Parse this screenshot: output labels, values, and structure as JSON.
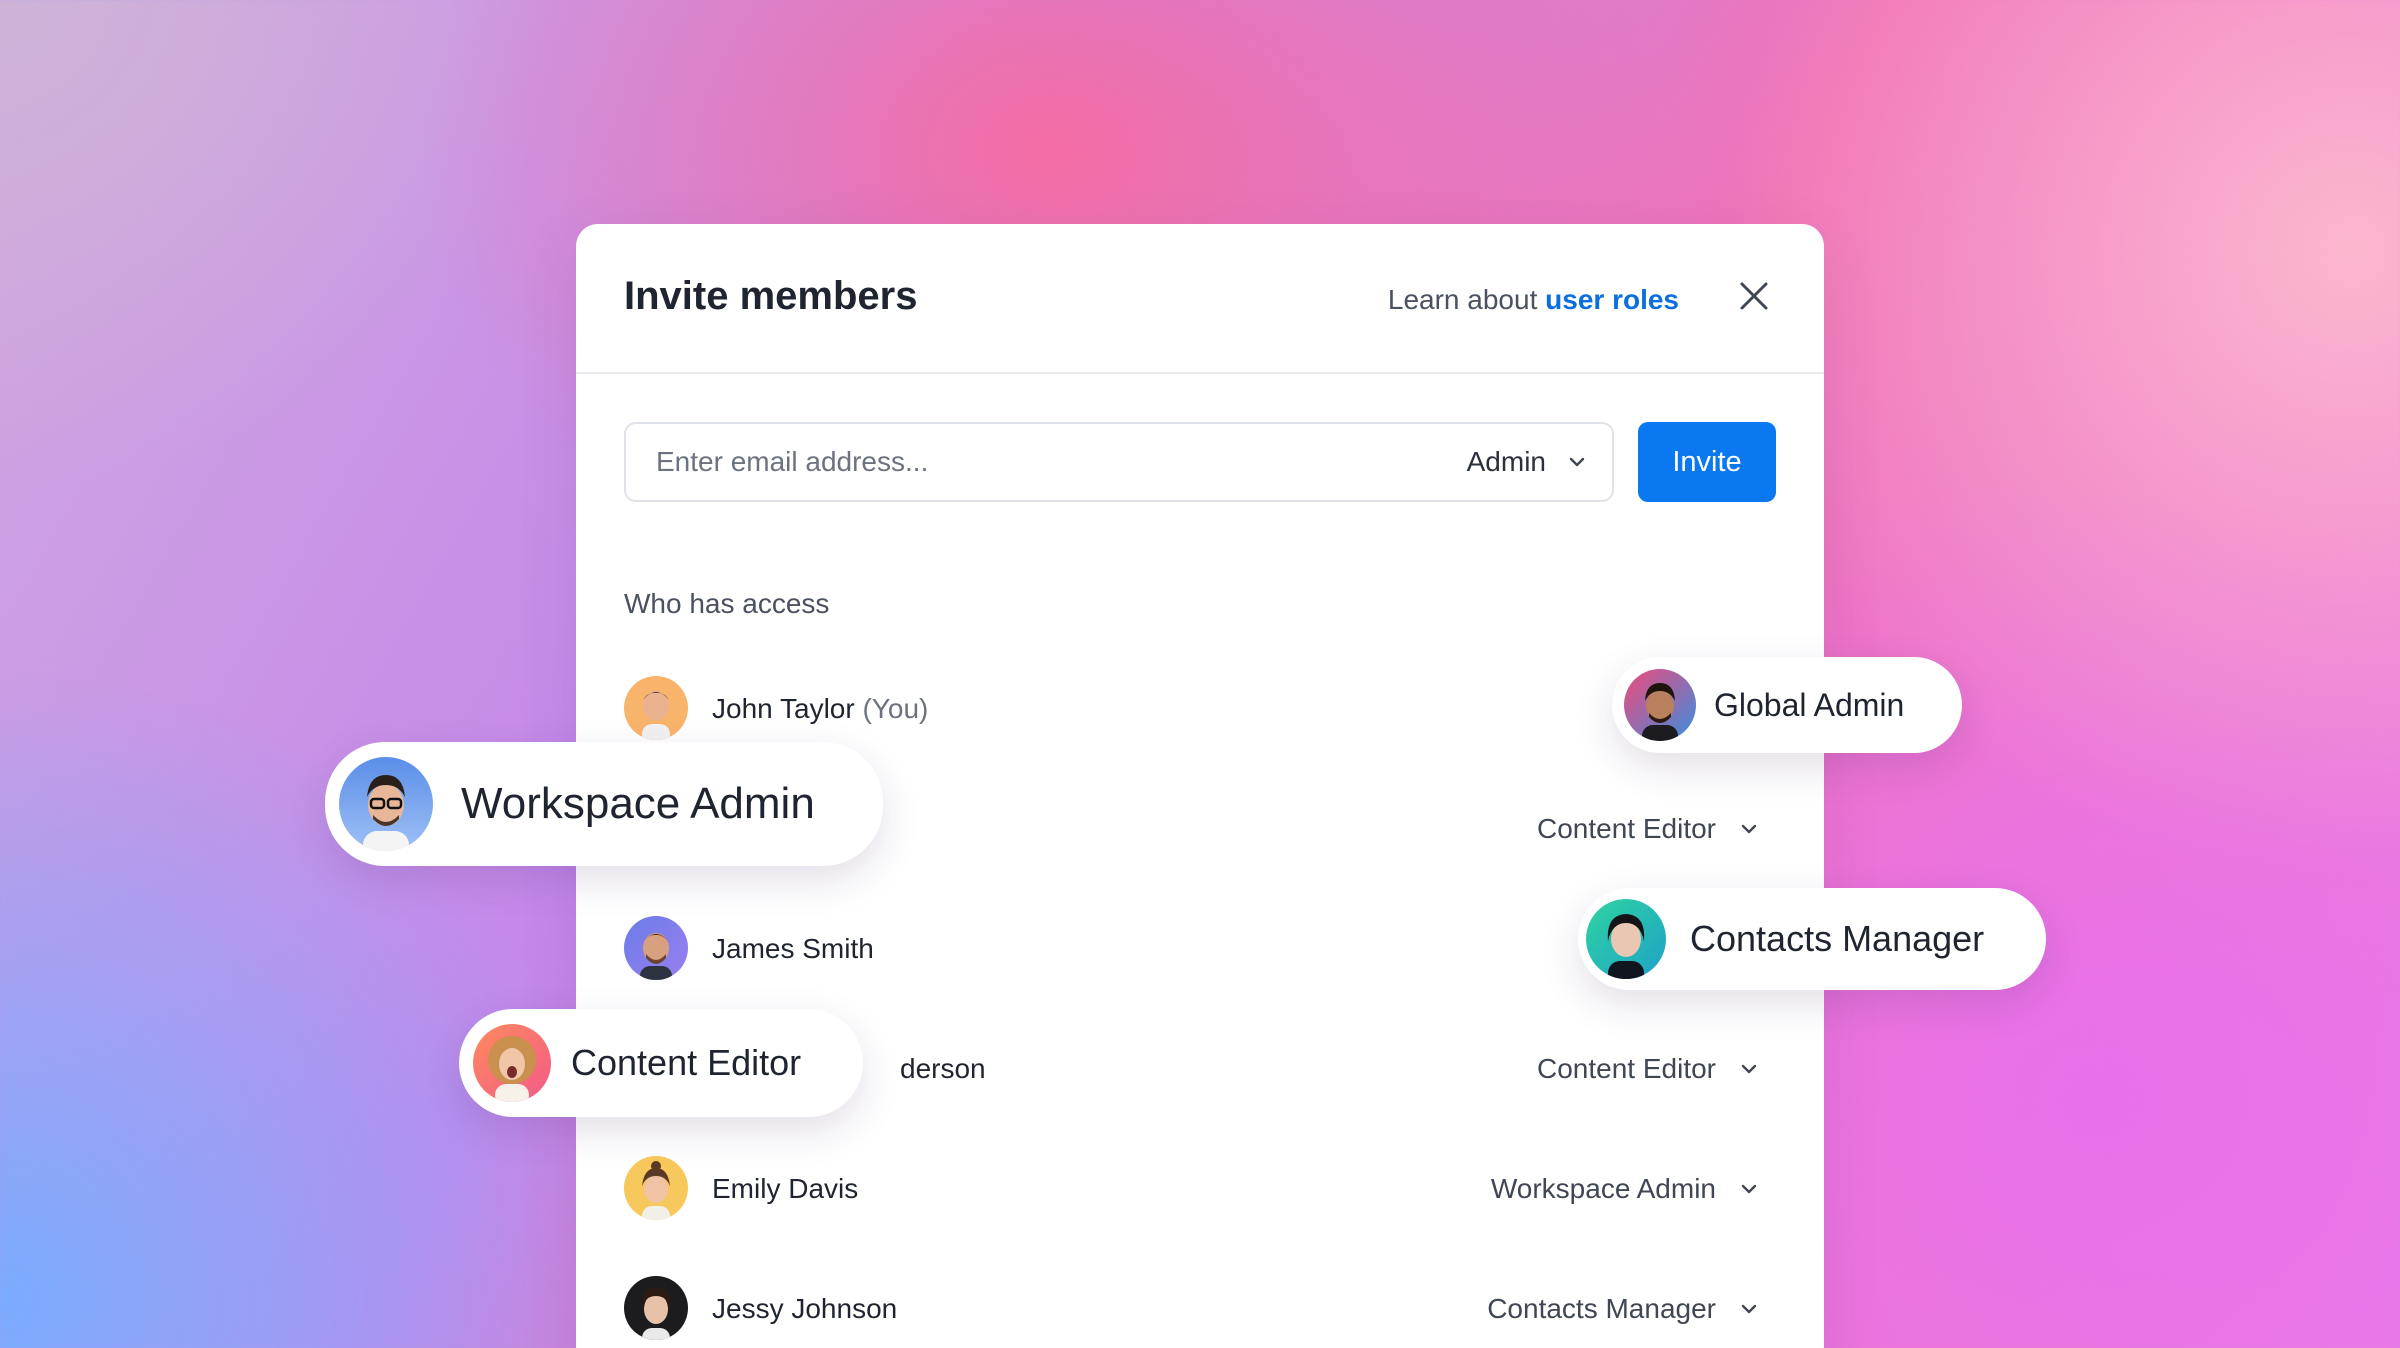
{
  "modal": {
    "title": "Invite members",
    "learn_prefix": "Learn about ",
    "learn_link": "user roles",
    "email_placeholder": "Enter email address...",
    "role_selected": "Admin",
    "invite_label": "Invite",
    "section_label": "Who has access"
  },
  "members": [
    {
      "name": "John Taylor",
      "suffix": "(You)",
      "role": ""
    },
    {
      "name": "",
      "suffix": "",
      "role": "Content Editor"
    },
    {
      "name": "James Smith",
      "suffix": "",
      "role": ""
    },
    {
      "name": "derson",
      "suffix": "",
      "role": "Content Editor"
    },
    {
      "name": "Emily Davis",
      "suffix": "",
      "role": "Workspace Admin"
    },
    {
      "name": "Jessy Johnson",
      "suffix": "",
      "role": "Contacts Manager"
    }
  ],
  "role_badges": [
    {
      "label": "Workspace Admin"
    },
    {
      "label": "Global Admin"
    },
    {
      "label": "Contacts Manager"
    },
    {
      "label": "Content Editor"
    }
  ],
  "colors": {
    "accent": "#0a78f0",
    "link": "#0b6fe0"
  }
}
